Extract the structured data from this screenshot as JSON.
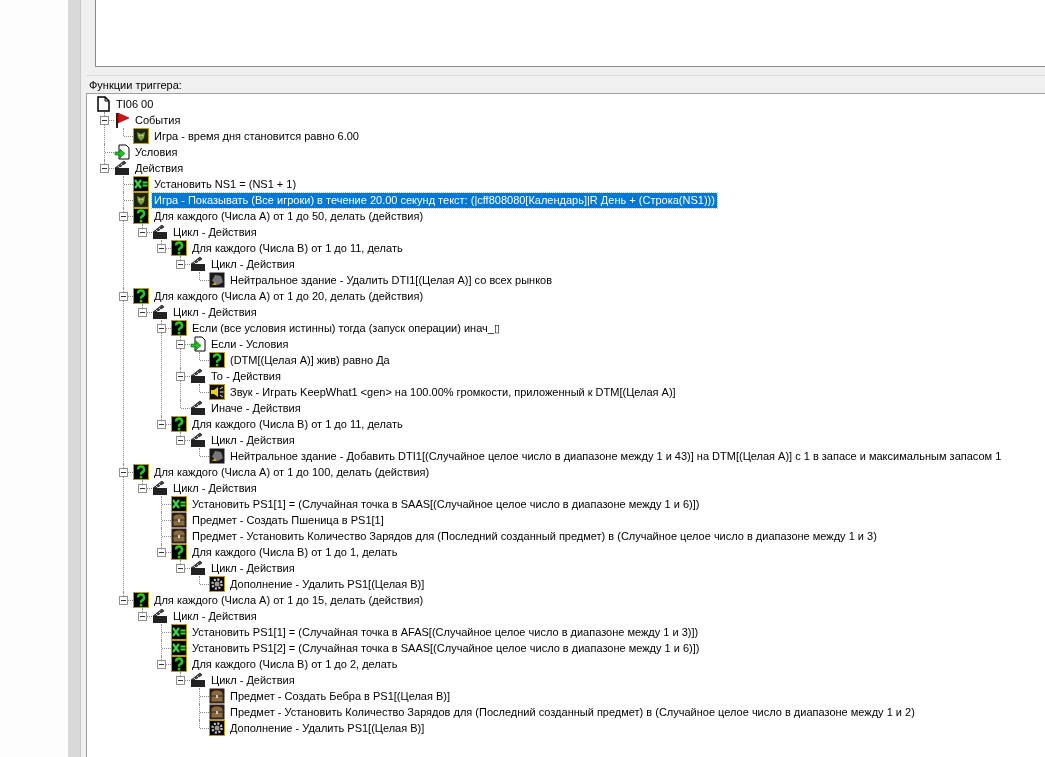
{
  "group_label": "Функции триггера:",
  "tree": {
    "kind": "document",
    "text": "TI06 00",
    "selected": false,
    "children": [
      {
        "kind": "flag",
        "text": "События",
        "selected": false,
        "expanded": true,
        "children": [
          {
            "kind": "game",
            "text": "Игра - время дня становится равно 6.00",
            "selected": false
          }
        ]
      },
      {
        "kind": "conditions",
        "text": "Условия",
        "selected": false
      },
      {
        "kind": "actions",
        "text": "Действия",
        "selected": false,
        "expanded": true,
        "children": [
          {
            "kind": "set",
            "text": "Установить NS1 = (NS1 + 1)",
            "selected": false
          },
          {
            "kind": "game",
            "text": "Игра - Показывать (Все игроки) в течение 20.00 секунд текст: (|cff808080[Календарь]|R День  + (Строка(NS1)))",
            "selected": true
          },
          {
            "kind": "loop",
            "text": "Для каждого (Числа A) от 1 до 50, делать (действия)",
            "selected": false,
            "expanded": true,
            "children": [
              {
                "kind": "actions",
                "text": "Цикл - Действия",
                "selected": false,
                "expanded": true,
                "children": [
                  {
                    "kind": "loop",
                    "text": "Для каждого (Числа B) от 1 до 11, делать",
                    "selected": false,
                    "expanded": true,
                    "children": [
                      {
                        "kind": "actions",
                        "text": "Цикл - Действия",
                        "selected": false,
                        "expanded": true,
                        "children": [
                          {
                            "kind": "building",
                            "text": "Нейтральное здание - Удалить DTI1[(Целая A)] со всех рынков",
                            "selected": false
                          }
                        ]
                      }
                    ]
                  }
                ]
              }
            ]
          },
          {
            "kind": "loop",
            "text": "Для каждого (Числа A) от 1 до 20, делать (действия)",
            "selected": false,
            "expanded": true,
            "children": [
              {
                "kind": "actions",
                "text": "Цикл - Действия",
                "selected": false,
                "expanded": true,
                "children": [
                  {
                    "kind": "loop",
                    "text": "Если (все условия истинны) тогда (запуск операции) инач_▯",
                    "selected": false,
                    "expanded": true,
                    "children": [
                      {
                        "kind": "conditions",
                        "text": "Если - Условия",
                        "selected": false,
                        "expanded": true,
                        "children": [
                          {
                            "kind": "loop",
                            "text": "(DTM[(Целая A)] жив) равно Да",
                            "selected": false
                          }
                        ]
                      },
                      {
                        "kind": "actions",
                        "text": "То - Действия",
                        "selected": false,
                        "expanded": true,
                        "children": [
                          {
                            "kind": "sound",
                            "text": "Звук - Играть KeepWhat1 <gen> на 100.00% громкости, приложенный к DTM[(Целая A)]",
                            "selected": false
                          }
                        ]
                      },
                      {
                        "kind": "actions",
                        "text": "Иначе - Действия",
                        "selected": false
                      }
                    ]
                  },
                  {
                    "kind": "loop",
                    "text": "Для каждого (Числа B) от 1 до 11, делать",
                    "selected": false,
                    "expanded": true,
                    "children": [
                      {
                        "kind": "actions",
                        "text": "Цикл - Действия",
                        "selected": false,
                        "expanded": true,
                        "children": [
                          {
                            "kind": "building",
                            "text": "Нейтральное здание - Добавить DTI1[(Случайное целое число в диапазоне между 1 и 43)] на DTM[(Целая A)] с 1 в запасе и максимальным запасом 1",
                            "selected": false
                          }
                        ]
                      }
                    ]
                  }
                ]
              }
            ]
          },
          {
            "kind": "loop",
            "text": "Для каждого (Числа A) от 1 до 100, делать (действия)",
            "selected": false,
            "expanded": true,
            "children": [
              {
                "kind": "actions",
                "text": "Цикл - Действия",
                "selected": false,
                "expanded": true,
                "children": [
                  {
                    "kind": "set",
                    "text": "Установить PS1[1] = (Случайная точка в SAAS[(Случайное целое число в диапазоне между 1 и 6)])",
                    "selected": false
                  },
                  {
                    "kind": "item",
                    "text": "Предмет - Создать Пшеница в PS1[1]",
                    "selected": false
                  },
                  {
                    "kind": "item",
                    "text": "Предмет - Установить Количество Зарядов для (Последний созданный предмет) в (Случайное целое число в диапазоне между 1 и 3)",
                    "selected": false
                  },
                  {
                    "kind": "loop",
                    "text": "Для каждого (Числа B) от 1 до 1, делать",
                    "selected": false,
                    "expanded": true,
                    "children": [
                      {
                        "kind": "actions",
                        "text": "Цикл - Действия",
                        "selected": false,
                        "expanded": true,
                        "children": [
                          {
                            "kind": "addon",
                            "text": "Дополнение -  Удалить PS1[(Целая B)]",
                            "selected": false
                          }
                        ]
                      }
                    ]
                  }
                ]
              }
            ]
          },
          {
            "kind": "loop",
            "text": "Для каждого (Числа A) от 1 до 15, делать (действия)",
            "selected": false,
            "expanded": true,
            "children": [
              {
                "kind": "actions",
                "text": "Цикл - Действия",
                "selected": false,
                "expanded": true,
                "children": [
                  {
                    "kind": "set",
                    "text": "Установить PS1[1] = (Случайная точка в AFAS[(Случайное целое число в диапазоне между 1 и 3)])",
                    "selected": false
                  },
                  {
                    "kind": "set",
                    "text": "Установить PS1[2] = (Случайная точка в SAAS[(Случайное целое число в диапазоне между 1 и 6)])",
                    "selected": false
                  },
                  {
                    "kind": "loop",
                    "text": "Для каждого (Числа B) от 1 до 2, делать",
                    "selected": false,
                    "expanded": true,
                    "children": [
                      {
                        "kind": "actions",
                        "text": "Цикл - Действия",
                        "selected": false,
                        "expanded": true,
                        "children": [
                          {
                            "kind": "item",
                            "text": "Предмет - Создать Бебра в PS1[(Целая B)]",
                            "selected": false
                          },
                          {
                            "kind": "item",
                            "text": "Предмет - Установить Количество Зарядов для (Последний созданный предмет) в (Случайное целое число в диапазоне между 1 и 2)",
                            "selected": false
                          },
                          {
                            "kind": "addon",
                            "text": "Дополнение -  Удалить PS1[(Целая B)]",
                            "selected": false
                          }
                        ]
                      }
                    ]
                  }
                ]
              }
            ]
          }
        ]
      }
    ]
  }
}
